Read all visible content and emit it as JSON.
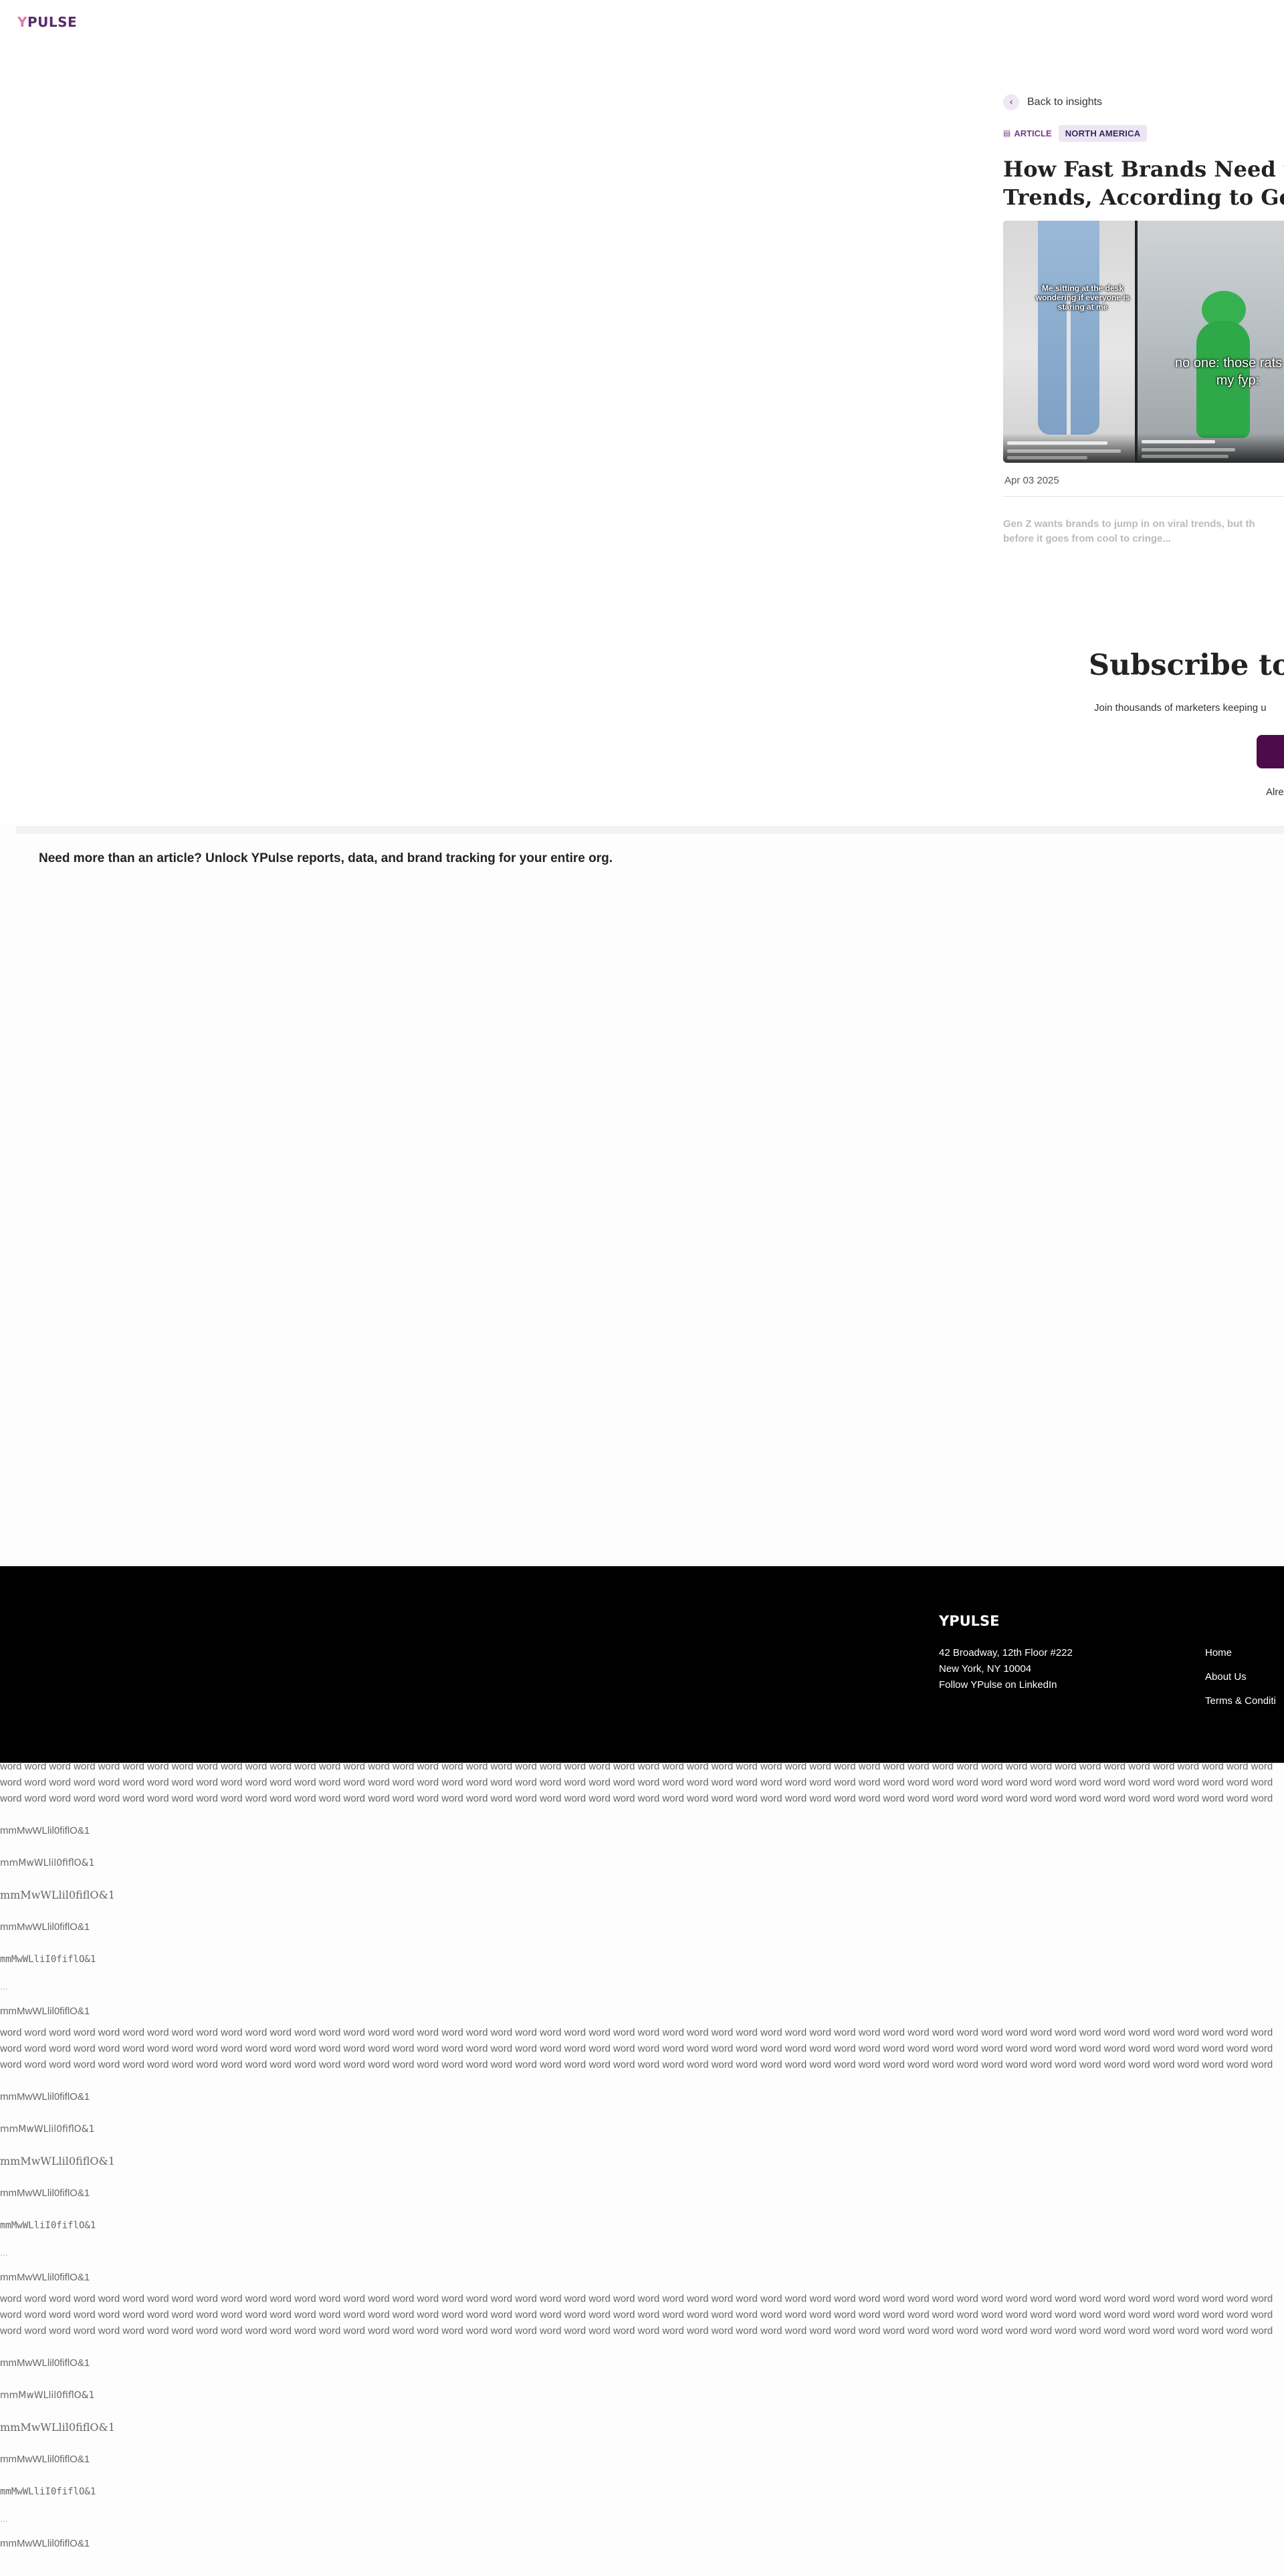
{
  "header": {
    "logo_y": "Y",
    "logo_rest": "PULSE"
  },
  "article": {
    "back_label": "Back to insights",
    "back_icon": "chevron-left-icon",
    "type_icon": "article-icon",
    "type_label": "ARTICLE",
    "region_label": "NORTH AMERICA",
    "title_line1": "How Fast Brands Need to Mo",
    "title_line2": "Trends, According to Gen Z",
    "hero_overlay_1": "Me sitting at the desk wondering if everyone is staring at me",
    "hero_overlay_2": "no one: those rats on my fyp:",
    "date": "Apr 03 2025",
    "download_icon": "download-icon",
    "teaser_line1": "Gen Z wants brands to jump in on viral trends, but th",
    "teaser_line2": "before it goes from cool to cringe..."
  },
  "subscribe": {
    "heading": "Subscribe to",
    "subtext": "Join thousands of marketers keeping u",
    "already": "Alre"
  },
  "cta": {
    "text": "Need more than an article? Unlock YPulse reports, data, and brand tracking for your entire org."
  },
  "footer": {
    "logo": "YPULSE",
    "address_line1": "42 Broadway, 12th Floor #222",
    "address_line2": "New York, NY 10004",
    "linkedin": "Follow YPulse on LinkedIn",
    "nav": [
      "Home",
      "About Us",
      "Terms & Conditi"
    ]
  },
  "test_blocks": [
    {
      "words": "word word word word word word word word word word word word word word word word word word word word word word word word word word word word word word word word word word word word word word word word word word word word word word word word word word word word word word word word word word word word word word word word word word word word word word word word word word word word word word word word word word word word word word word word word word word word word word word word word word word word word word word word word word word word word word word word word word word word word word word word word word word word word word word word word word word word word word word word word word word word word word word word word word word word word word word word word word word word word word word word word word word word word word word word word word word word word word word word word word word word word word word word word word word word word word word word word word word word word word word word word word word word word word word word word word word word word word word word word word word word word word word word word word word word word word word word word word word word word word word word word word word word word word",
      "probes": [
        "mmMwWLlil0fiflO&1",
        "mmMwWLlil0fiflO&1",
        "mmMwWLlil0fiflO&1",
        "mmMwWLlil0fiflO&1",
        "mmMwWLliI0fiflO&1"
      ],
      "ellipsis": "…",
      "probe_last": "mmMwWLlil0fiflO&1"
    },
    {
      "words": "word word word word word word word word word word word word word word word word word word word word word word word word word word word word word word word word word word word word word word word word word word word word word word word word word word word word word word word word word word word word word word word word word word word word word word word word word word word word word word word word word word word word word word word word word word word word word word word word word word word word word word word word word word word word word word word word word word word word word word word word word word word word word word word word word word word word word word word word word word word word word word word word word word word word word word word word word word word word word word word word word word word word word word word word word word word word word word word word word word word word word word word word word word word word word word word word word word word word word word word word word word word word word word word word word word word word word word word word word word word word word word word word word word word word word word word word word word word word word word word word word word word word word",
      "probes": [
        "mmMwWLlil0fiflO&1",
        "mmMwWLlil0fiflO&1",
        "mmMwWLlil0fiflO&1",
        "mmMwWLlil0fiflO&1",
        "mmMwWLliI0fiflO&1"
      ],
      "ellipsis": "…",
      "probe_last": "mmMwWLlil0fiflO&1"
    },
    {
      "words": "word word word word word word word word word word word word word word word word word word word word word word word word word word word word word word word word word word word word word word word word word word word word word word word word word word word word word word word word word word word word word word word word word word word word word word word word word word word word word word word word word word word word word word word word word word word word word word word word word word word word word word word word word word word word word word word word word word word word word word word word word word word word word word word word word word word word word word word word word word word word word word word word word word word word word word word word word word word word word word word word word word word word word word word word word word word word word word word word word word word word word word word word word word word word word word word word word word word word word word word word word word word word word word word word word word word word word word word word word word word word word word word word word word word word word word word word word word word word word word word word word word word word word",
      "probes": [
        "mmMwWLlil0fiflO&1",
        "mmMwWLlil0fiflO&1",
        "mmMwWLlil0fiflO&1",
        "mmMwWLlil0fiflO&1",
        "mmMwWLliI0fiflO&1"
      ],
      "ellipsis": "…",
      "probe_last": "mmMwWLlil0fiflO&1"
    }
  ]
}
